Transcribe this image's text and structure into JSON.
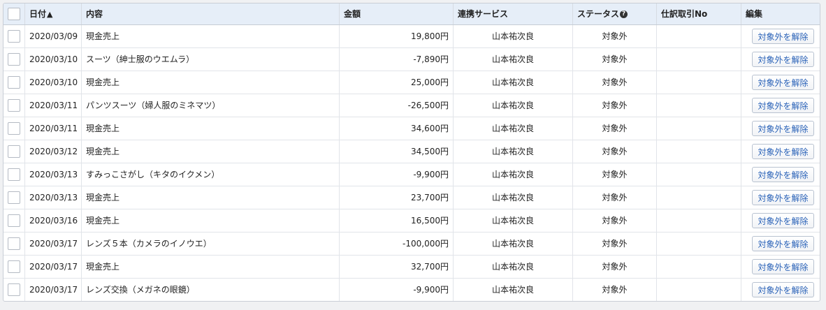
{
  "header": {
    "date": "日付",
    "description": "内容",
    "amount": "金額",
    "service": "連携サービス",
    "status": "ステータス",
    "journal_no": "仕訳取引No",
    "edit": "編集"
  },
  "icons": {
    "sort": "arrow-up-icon",
    "help": "question-circle-icon"
  },
  "colors": {
    "header_bg": "#e6eef8",
    "button_text": "#2b63b8"
  },
  "rows": [
    {
      "date": "2020/03/09",
      "description": "現金売上",
      "amount": "19,800円",
      "service": "山本祐次良",
      "status": "対象外",
      "journal_no": "",
      "action": "対象外を解除"
    },
    {
      "date": "2020/03/10",
      "description": "スーツ（紳士服のウエムラ）",
      "amount": "-7,890円",
      "service": "山本祐次良",
      "status": "対象外",
      "journal_no": "",
      "action": "対象外を解除"
    },
    {
      "date": "2020/03/10",
      "description": "現金売上",
      "amount": "25,000円",
      "service": "山本祐次良",
      "status": "対象外",
      "journal_no": "",
      "action": "対象外を解除"
    },
    {
      "date": "2020/03/11",
      "description": "パンツスーツ（婦人服のミネマツ）",
      "amount": "-26,500円",
      "service": "山本祐次良",
      "status": "対象外",
      "journal_no": "",
      "action": "対象外を解除"
    },
    {
      "date": "2020/03/11",
      "description": "現金売上",
      "amount": "34,600円",
      "service": "山本祐次良",
      "status": "対象外",
      "journal_no": "",
      "action": "対象外を解除"
    },
    {
      "date": "2020/03/12",
      "description": "現金売上",
      "amount": "34,500円",
      "service": "山本祐次良",
      "status": "対象外",
      "journal_no": "",
      "action": "対象外を解除"
    },
    {
      "date": "2020/03/13",
      "description": "すみっこさがし（キタのイクメン）",
      "amount": "-9,900円",
      "service": "山本祐次良",
      "status": "対象外",
      "journal_no": "",
      "action": "対象外を解除"
    },
    {
      "date": "2020/03/13",
      "description": "現金売上",
      "amount": "23,700円",
      "service": "山本祐次良",
      "status": "対象外",
      "journal_no": "",
      "action": "対象外を解除"
    },
    {
      "date": "2020/03/16",
      "description": "現金売上",
      "amount": "16,500円",
      "service": "山本祐次良",
      "status": "対象外",
      "journal_no": "",
      "action": "対象外を解除"
    },
    {
      "date": "2020/03/17",
      "description": "レンズ５本（カメラのイノウエ）",
      "amount": "-100,000円",
      "service": "山本祐次良",
      "status": "対象外",
      "journal_no": "",
      "action": "対象外を解除"
    },
    {
      "date": "2020/03/17",
      "description": "現金売上",
      "amount": "32,700円",
      "service": "山本祐次良",
      "status": "対象外",
      "journal_no": "",
      "action": "対象外を解除"
    },
    {
      "date": "2020/03/17",
      "description": "レンズ交換（メガネの眼鏡）",
      "amount": "-9,900円",
      "service": "山本祐次良",
      "status": "対象外",
      "journal_no": "",
      "action": "対象外を解除"
    }
  ]
}
